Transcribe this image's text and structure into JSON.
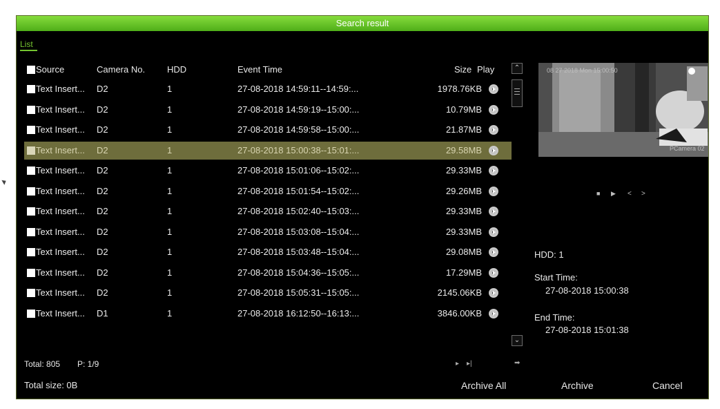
{
  "window": {
    "title": "Search result"
  },
  "tabs": [
    {
      "label": "List"
    }
  ],
  "table": {
    "columns": {
      "source": "Source",
      "camera": "Camera No.",
      "hdd": "HDD",
      "event_time": "Event Time",
      "size": "Size",
      "play": "Play"
    },
    "rows": [
      {
        "source": "Text Insert...",
        "camera": "D2",
        "hdd": "1",
        "event_time": "27-08-2018 14:59:11--14:59:...",
        "size": "1978.76KB",
        "selected": false
      },
      {
        "source": "Text Insert...",
        "camera": "D2",
        "hdd": "1",
        "event_time": "27-08-2018 14:59:19--15:00:...",
        "size": "10.79MB",
        "selected": false
      },
      {
        "source": "Text Insert...",
        "camera": "D2",
        "hdd": "1",
        "event_time": "27-08-2018 14:59:58--15:00:...",
        "size": "21.87MB",
        "selected": false
      },
      {
        "source": "Text Insert...",
        "camera": "D2",
        "hdd": "1",
        "event_time": "27-08-2018 15:00:38--15:01:...",
        "size": "29.58MB",
        "selected": true
      },
      {
        "source": "Text Insert...",
        "camera": "D2",
        "hdd": "1",
        "event_time": "27-08-2018 15:01:06--15:02:...",
        "size": "29.33MB",
        "selected": false
      },
      {
        "source": "Text Insert...",
        "camera": "D2",
        "hdd": "1",
        "event_time": "27-08-2018 15:01:54--15:02:...",
        "size": "29.26MB",
        "selected": false
      },
      {
        "source": "Text Insert...",
        "camera": "D2",
        "hdd": "1",
        "event_time": "27-08-2018 15:02:40--15:03:...",
        "size": "29.33MB",
        "selected": false
      },
      {
        "source": "Text Insert...",
        "camera": "D2",
        "hdd": "1",
        "event_time": "27-08-2018 15:03:08--15:04:...",
        "size": "29.33MB",
        "selected": false
      },
      {
        "source": "Text Insert...",
        "camera": "D2",
        "hdd": "1",
        "event_time": "27-08-2018 15:03:48--15:04:...",
        "size": "29.08MB",
        "selected": false
      },
      {
        "source": "Text Insert...",
        "camera": "D2",
        "hdd": "1",
        "event_time": "27-08-2018 15:04:36--15:05:...",
        "size": "17.29MB",
        "selected": false
      },
      {
        "source": "Text Insert...",
        "camera": "D2",
        "hdd": "1",
        "event_time": "27-08-2018 15:05:31--15:05:...",
        "size": "2145.06KB",
        "selected": false
      },
      {
        "source": "Text Insert...",
        "camera": "D1",
        "hdd": "1",
        "event_time": "27-08-2018 16:12:50--16:13:...",
        "size": "3846.00KB",
        "selected": false
      }
    ]
  },
  "preview": {
    "osd_top": "08 27 2018 Mon 15:00:50",
    "osd_bottom": "PCamera 02",
    "controls": [
      "■",
      "▶",
      "<",
      ">"
    ]
  },
  "details": {
    "hdd_label": "HDD: 1",
    "start_label": "Start Time:",
    "start_value": "27-08-2018 15:00:38",
    "end_label": "End Time:",
    "end_value": "27-08-2018 15:01:38"
  },
  "pagination": {
    "total": "Total: 805",
    "page": "P: 1/9",
    "next": "▸",
    "last": "▸|",
    "go": "➡"
  },
  "footer": {
    "total_size": "Total size: 0B",
    "archive_all": "Archive All",
    "archive": "Archive",
    "cancel": "Cancel"
  },
  "colors": {
    "title_green": "#5fc224",
    "selected_row": "#6e6d3c",
    "accent": "#75c530"
  }
}
